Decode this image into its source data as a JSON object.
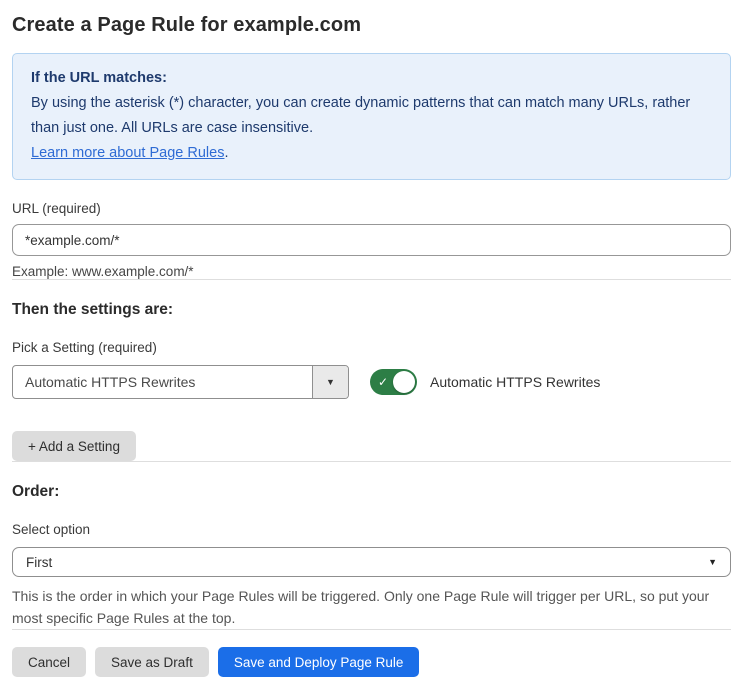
{
  "page": {
    "title": "Create a Page Rule for example.com"
  },
  "info_box": {
    "heading": "If the URL matches:",
    "body": "By using the asterisk (*) character, you can create dynamic patterns that can match many URLs, rather than just one. All URLs are case insensitive.",
    "link_text": "Learn more about Page Rules",
    "link_suffix": "."
  },
  "url_field": {
    "label": "URL (required)",
    "value": "*example.com/*",
    "hint": "Example: www.example.com/*"
  },
  "settings_section": {
    "heading": "Then the settings are:",
    "picker_label": "Pick a Setting (required)",
    "selected_setting": "Automatic HTTPS Rewrites",
    "dropdown_arrow": "▼",
    "toggle": {
      "state": "on",
      "check_glyph": "✓",
      "label": "Automatic HTTPS Rewrites"
    },
    "add_button_label": "+ Add a Setting"
  },
  "order_section": {
    "heading": "Order:",
    "label": "Select option",
    "selected_option": "First",
    "dropdown_arrow": "▼",
    "description": "This is the order in which your Page Rules will be triggered. Only one Page Rule will trigger per URL, so put your most specific Page Rules at the top."
  },
  "footer": {
    "cancel_label": "Cancel",
    "save_draft_label": "Save as Draft",
    "save_deploy_label": "Save and Deploy Page Rule"
  },
  "colors": {
    "accent_blue": "#1b6ee8",
    "toggle_green": "#2d7e46",
    "info_background": "#e9f1fb",
    "info_border": "#b3d3f1",
    "info_text": "#1e3a6d",
    "link_blue": "#2e6bd4",
    "button_gray": "#dcdcdc"
  }
}
